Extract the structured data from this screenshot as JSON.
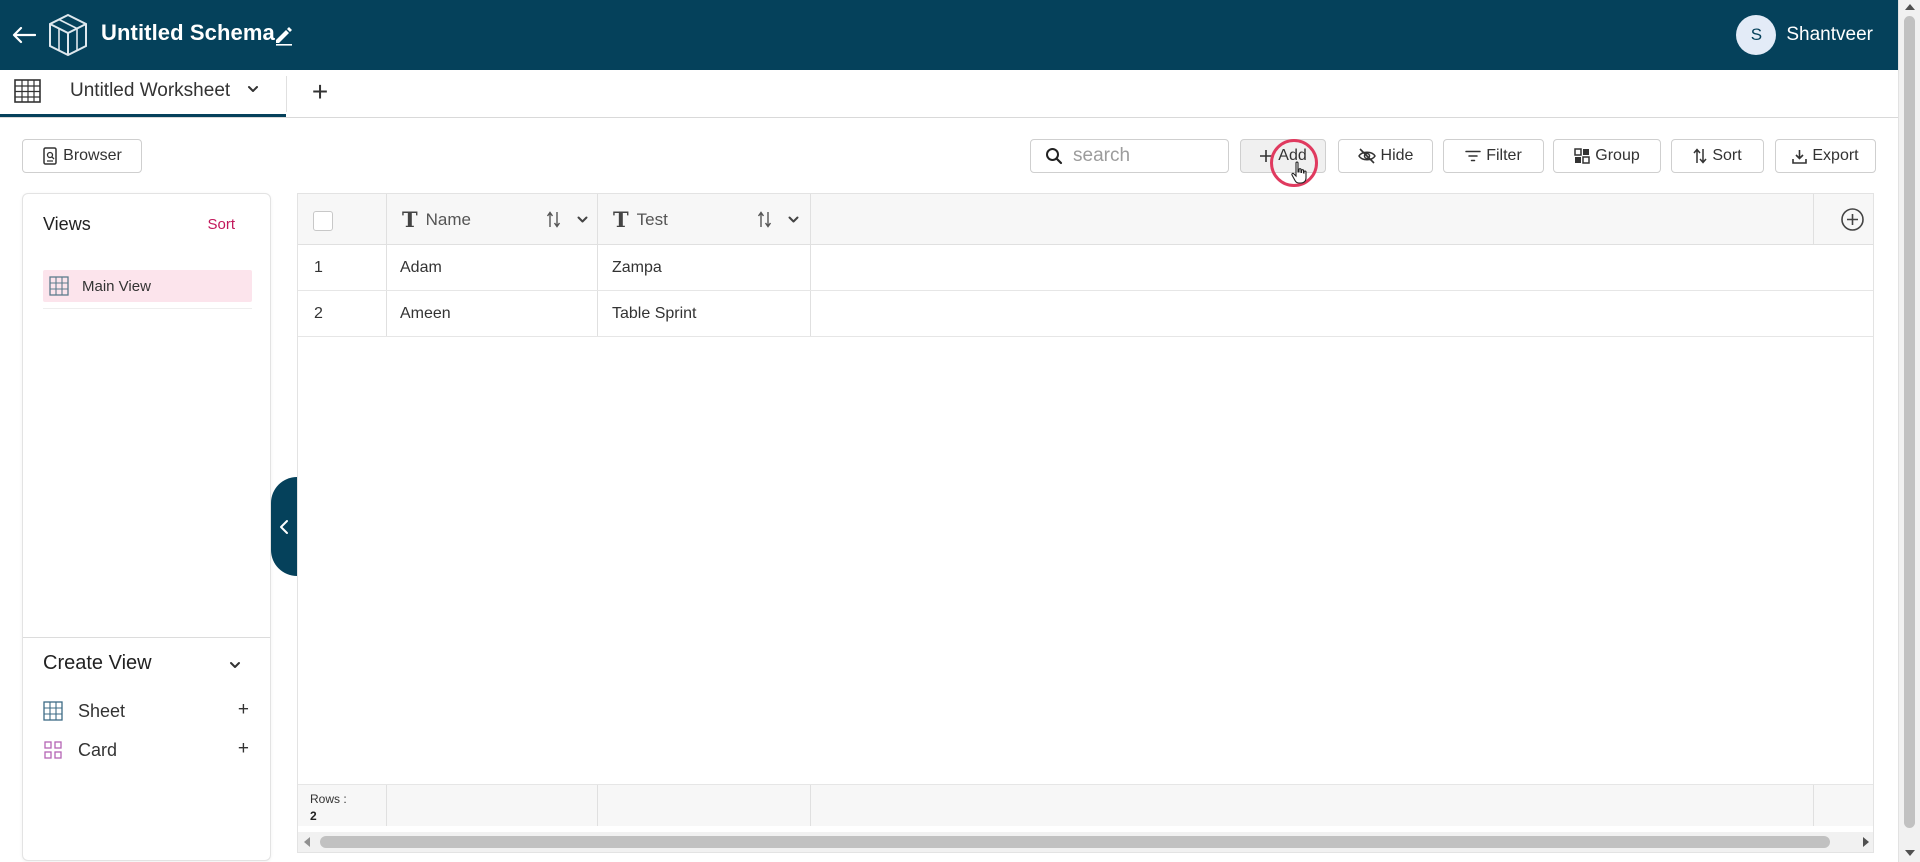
{
  "header": {
    "schema_title": "Untitled Schema",
    "user": {
      "initial": "S",
      "name": "Shantveer"
    }
  },
  "tabs": {
    "worksheet_label": "Untitled Worksheet",
    "add_tab_label": "+"
  },
  "toolbar": {
    "browser_label": "Browser",
    "search_placeholder": "search",
    "add_label": "Add",
    "hide_label": "Hide",
    "filter_label": "Filter",
    "group_label": "Group",
    "sort_label": "Sort",
    "export_label": "Export"
  },
  "sidebar": {
    "views_title": "Views",
    "views_sort_label": "Sort",
    "views": [
      {
        "label": "Main View",
        "icon": "grid-icon"
      }
    ],
    "create_view_title": "Create View",
    "create_items": [
      {
        "label": "Sheet",
        "icon": "sheet-grid-icon",
        "add": "+"
      },
      {
        "label": "Card",
        "icon": "card-grid-icon",
        "add": "+"
      }
    ]
  },
  "grid": {
    "columns": [
      {
        "name": "Name",
        "type_glyph": "T"
      },
      {
        "name": "Test",
        "type_glyph": "T"
      }
    ],
    "rows": [
      {
        "index": "1",
        "name": "Adam",
        "test": "Zampa"
      },
      {
        "index": "2",
        "name": "Ameen",
        "test": "Table Sprint"
      }
    ],
    "footer": {
      "rows_label": "Rows :",
      "rows_count": "2"
    }
  },
  "colors": {
    "header_bg": "#05415b",
    "accent_pink": "#c2185b",
    "selected_view_bg": "#fce4ec",
    "click_ring": "#e03a5f"
  }
}
